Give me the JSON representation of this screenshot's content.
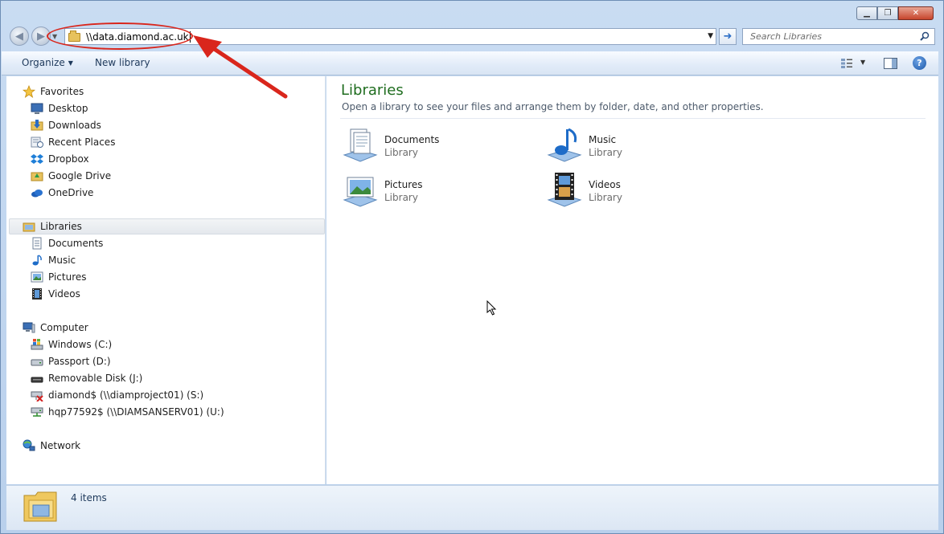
{
  "address_bar": {
    "path": "\\\\data.diamond.ac.uk"
  },
  "search": {
    "placeholder": "Search Libraries"
  },
  "toolbar": {
    "organize_label": "Organize",
    "new_library_label": "New library"
  },
  "navigation": {
    "favorites": {
      "label": "Favorites",
      "items": [
        "Desktop",
        "Downloads",
        "Recent Places",
        "Dropbox",
        "Google Drive",
        "OneDrive"
      ]
    },
    "libraries": {
      "label": "Libraries",
      "items": [
        "Documents",
        "Music",
        "Pictures",
        "Videos"
      ]
    },
    "computer": {
      "label": "Computer",
      "items": [
        "Windows (C:)",
        "Passport (D:)",
        "Removable Disk (J:)",
        "diamond$ (\\\\diamproject01) (S:)",
        "hqp77592$ (\\\\DIAMSANSERV01) (U:)"
      ]
    },
    "network": {
      "label": "Network"
    }
  },
  "content": {
    "title": "Libraries",
    "subtitle": "Open a library to see your files and arrange them by folder, date, and other properties.",
    "libraries": [
      {
        "name": "Documents",
        "type": "Library"
      },
      {
        "name": "Music",
        "type": "Library"
      },
      {
        "name": "Pictures",
        "type": "Library"
      },
      {
        "name": "Videos",
        "type": "Library"
      }
    ]
  },
  "details": {
    "item_count": "4 items"
  },
  "colors": {
    "annotation_red": "#d9261c",
    "title_green": "#1f6d1f",
    "accent_blue": "#2c6fc7"
  }
}
